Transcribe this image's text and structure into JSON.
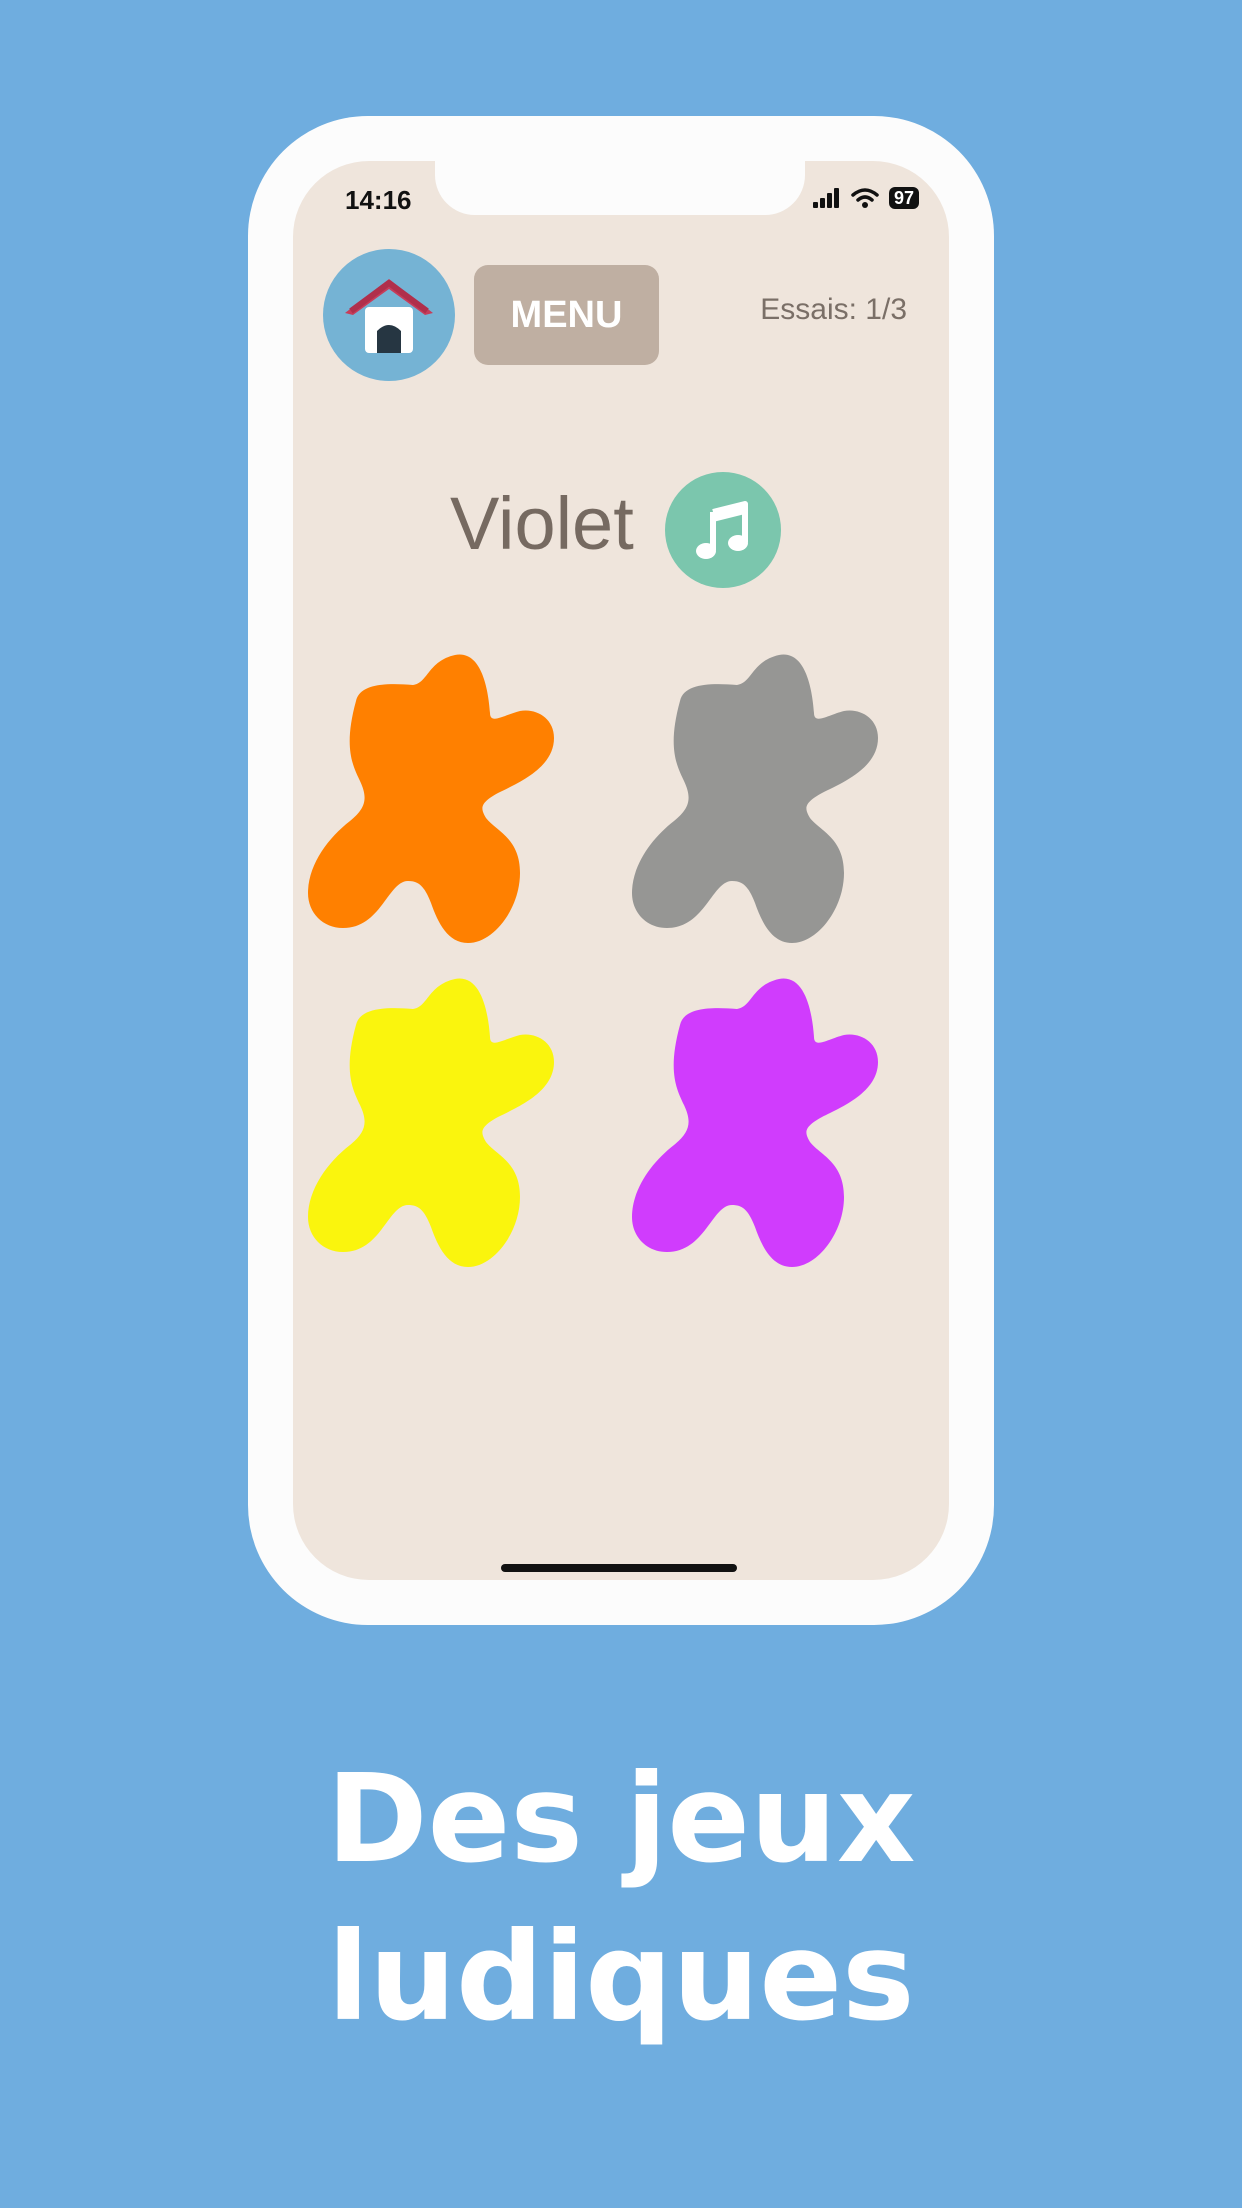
{
  "status_bar": {
    "time": "14:16",
    "battery": "97"
  },
  "header": {
    "menu_label": "MENU",
    "attempts": "Essais: 1/3"
  },
  "prompt": {
    "color_word": "Violet"
  },
  "blobs": [
    {
      "color_name": "orange",
      "color": "#ff8000"
    },
    {
      "color_name": "gray",
      "color": "#969694"
    },
    {
      "color_name": "yellow",
      "color": "#faf50d"
    },
    {
      "color_name": "purple",
      "color": "#d03cfd"
    }
  ],
  "caption": {
    "line1": "Des jeux",
    "line2": "ludiques"
  },
  "colors": {
    "background": "#6faddf",
    "screen": "#efe5dc",
    "home_button": "#75b3d4",
    "menu_button": "#bfafa2",
    "music_button": "#7bc6ad"
  },
  "icons": [
    "house-icon",
    "music-note-icon",
    "signal-icon",
    "wifi-icon",
    "battery-icon"
  ]
}
